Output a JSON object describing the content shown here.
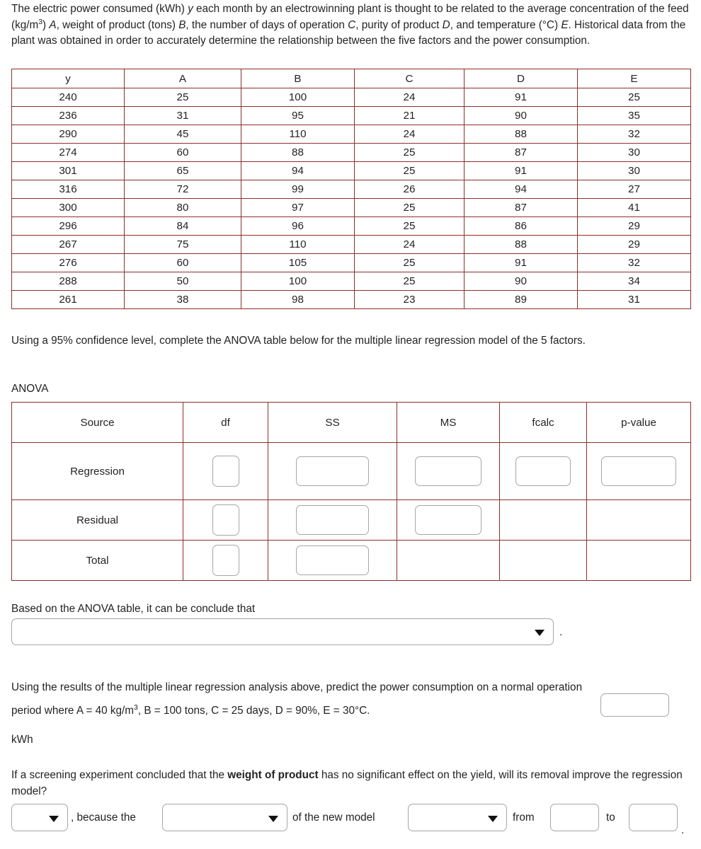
{
  "intro": {
    "p1_a": "The electric power consumed (kWh) ",
    "p1_y": "y",
    "p1_b": " each month by an electrowinning plant is thought to be related to the average concentration of the feed (kg/m",
    "p1_sup3": "3",
    "p1_c": ") ",
    "p1_A": "A",
    "p1_d": ", weight of product (tons) ",
    "p1_B": "B",
    "p1_e": ", the number of days of operation ",
    "p1_C": "C",
    "p1_f": ", purity of product ",
    "p1_D": "D",
    "p1_g": ", and temperature (°C) ",
    "p1_E": "E",
    "p1_h": ". Historical data from the plant was obtained in order to accurately determine the relationship between the five factors and the power consumption."
  },
  "data_table": {
    "headers": [
      "y",
      "A",
      "B",
      "C",
      "D",
      "E"
    ],
    "rows": [
      [
        "240",
        "25",
        "100",
        "24",
        "91",
        "25"
      ],
      [
        "236",
        "31",
        "95",
        "21",
        "90",
        "35"
      ],
      [
        "290",
        "45",
        "110",
        "24",
        "88",
        "32"
      ],
      [
        "274",
        "60",
        "88",
        "25",
        "87",
        "30"
      ],
      [
        "301",
        "65",
        "94",
        "25",
        "91",
        "30"
      ],
      [
        "316",
        "72",
        "99",
        "26",
        "94",
        "27"
      ],
      [
        "300",
        "80",
        "97",
        "25",
        "87",
        "41"
      ],
      [
        "296",
        "84",
        "96",
        "25",
        "86",
        "29"
      ],
      [
        "267",
        "75",
        "110",
        "24",
        "88",
        "29"
      ],
      [
        "276",
        "60",
        "105",
        "25",
        "91",
        "32"
      ],
      [
        "288",
        "50",
        "100",
        "25",
        "90",
        "34"
      ],
      [
        "261",
        "38",
        "98",
        "23",
        "89",
        "31"
      ]
    ]
  },
  "anova_prompt": "Using a 95% confidence level, complete the ANOVA table below for the multiple linear regression model of the 5 factors.",
  "anova_label": "ANOVA",
  "anova_table": {
    "headers": [
      "Source",
      "df",
      "SS",
      "MS",
      "fcalc",
      "p-value"
    ],
    "row_labels": {
      "regression": "Regression",
      "residual": "Residual",
      "total": "Total"
    },
    "values": {
      "regression": {
        "df": "",
        "ss": "",
        "ms": "",
        "fcalc": "",
        "pvalue": ""
      },
      "residual": {
        "df": "",
        "ss": "",
        "ms": ""
      },
      "total": {
        "df": "",
        "ss": ""
      }
    }
  },
  "conclusion": {
    "prompt": "Based on the ANOVA table, it can be conclude that",
    "selected": "",
    "trailing_punctuation": "."
  },
  "prediction": {
    "text_a": "Using the results of the multiple linear regression analysis above, predict the power consumption on a normal operation period where A = 40 kg/m",
    "sup3": "3",
    "text_b": ", B = 100 tons, C = 25 days, D = 90%, E = 30°C.",
    "answer": "",
    "unit": "kWh"
  },
  "screening": {
    "text_a": "If a screening experiment concluded that the ",
    "bold": "weight of product",
    "text_b": " has no significant effect on the yield, will its removal improve the regression model?",
    "yesno_selected": "",
    "between_1": ", because the",
    "metric_selected": "",
    "between_2": "of the new model",
    "change_selected": "",
    "between_3": "from",
    "from_value": "",
    "between_4": "to",
    "to_value": "",
    "trailing_punctuation": "."
  },
  "colors": {
    "table_border": "#8b2f2b",
    "input_border": "#a6a6a6",
    "text": "#232323",
    "background": "#ffffff"
  }
}
